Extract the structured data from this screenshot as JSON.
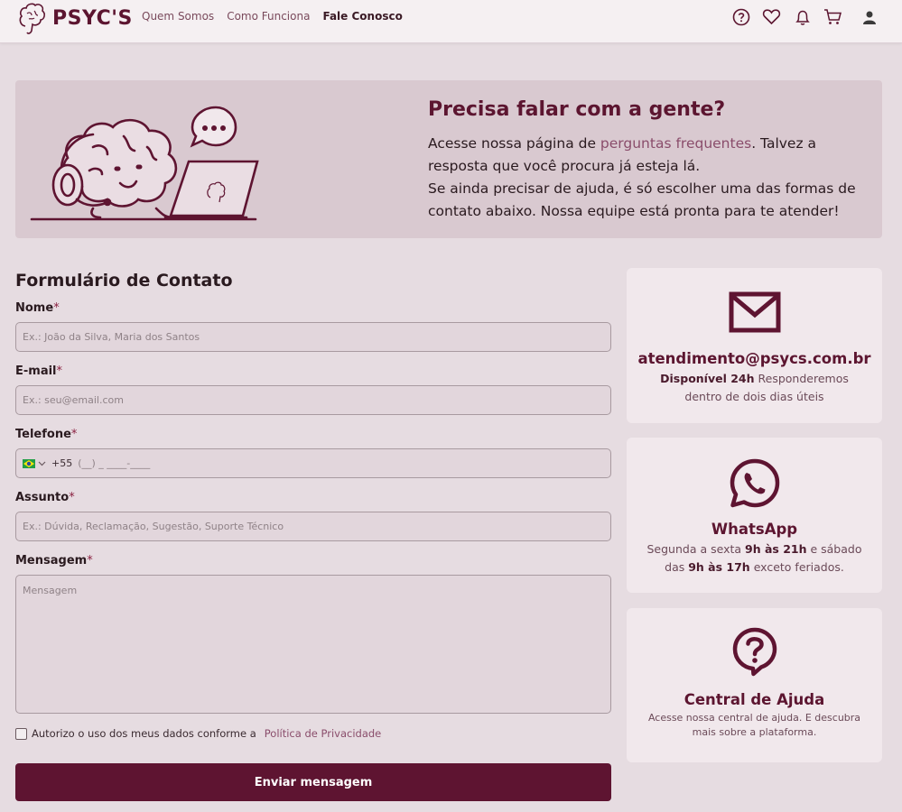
{
  "header": {
    "logo_text": "PSYC'S",
    "nav": [
      {
        "label": "Quem Somos"
      },
      {
        "label": "Como Funciona"
      },
      {
        "label": "Fale Conosco"
      }
    ],
    "icons": [
      "help-icon",
      "heart-icon",
      "bell-icon",
      "cart-icon",
      "user-icon"
    ]
  },
  "banner": {
    "title": "Precisa falar com a gente?",
    "line1_prefix": "Acesse nossa página de ",
    "line1_link": "perguntas frequentes",
    "line1_suffix": ". Talvez a resposta que você procura já esteja lá.",
    "line2": "Se ainda precisar de ajuda, é só escolher uma das formas de contato abaixo. Nossa equipe está pronta para te atender!"
  },
  "form": {
    "title": "Formulário de Contato",
    "required_mark": "*",
    "name_label": "Nome",
    "name_placeholder": "Ex.: João da Silva, Maria dos Santos",
    "email_label": "E-mail",
    "email_placeholder": "Ex.: seu@email.com",
    "phone_label": "Telefone",
    "phone_code": "+55",
    "phone_mask": "(__) _ ____-____",
    "subject_label": "Assunto",
    "subject_placeholder": "Ex.: Dúvida, Reclamação, Sugestão, Suporte Técnico",
    "message_label": "Mensagem",
    "message_placeholder": "Mensagem",
    "consent_text": "Autorizo o uso dos meus dados conforme a",
    "consent_link": "Política de Privacidade",
    "submit_label": "Enviar mensagem"
  },
  "cards": {
    "email": {
      "title": "atendimento@psycs.com.br",
      "bold": "Disponível 24h",
      "text": " Responderemos dentro de dois dias úteis"
    },
    "whatsapp": {
      "title": "WhatsApp",
      "t1": "Segunda a sexta ",
      "b1": "9h às 21h",
      "t2": " e sábado das ",
      "b2": "9h às 17h",
      "t3": " exceto feriados."
    },
    "help": {
      "title": "Central de Ajuda",
      "text": "Acesse nossa central de ajuda. E descubra mais sobre a plataforma."
    }
  },
  "colors": {
    "brand": "#5e1431",
    "background": "#e6dce1",
    "banner": "#d9c9d0",
    "card": "#f1e8ec",
    "link": "#8a4d6b"
  }
}
